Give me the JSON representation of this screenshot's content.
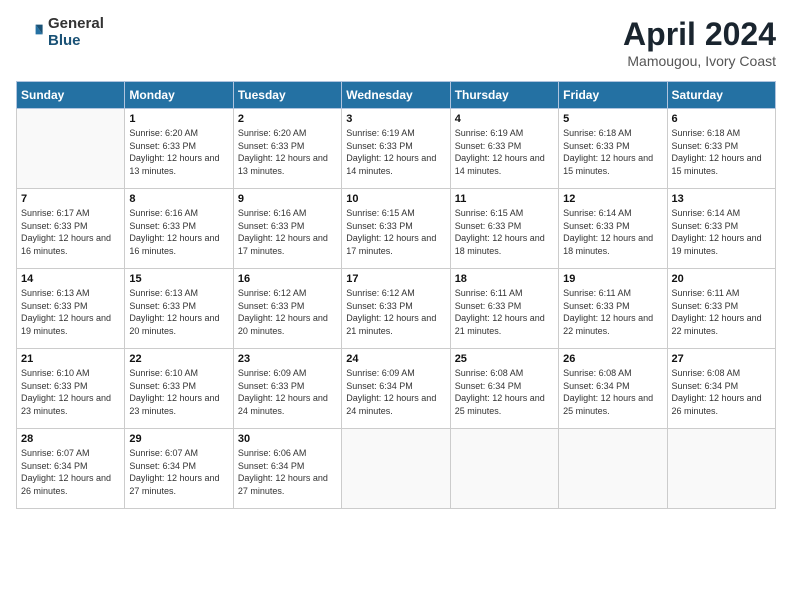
{
  "header": {
    "logo_general": "General",
    "logo_blue": "Blue",
    "title": "April 2024",
    "subtitle": "Mamougou, Ivory Coast"
  },
  "days_of_week": [
    "Sunday",
    "Monday",
    "Tuesday",
    "Wednesday",
    "Thursday",
    "Friday",
    "Saturday"
  ],
  "weeks": [
    [
      {
        "day": "",
        "empty": true
      },
      {
        "day": "1",
        "sunrise": "6:20 AM",
        "sunset": "6:33 PM",
        "daylight": "12 hours and 13 minutes."
      },
      {
        "day": "2",
        "sunrise": "6:20 AM",
        "sunset": "6:33 PM",
        "daylight": "12 hours and 13 minutes."
      },
      {
        "day": "3",
        "sunrise": "6:19 AM",
        "sunset": "6:33 PM",
        "daylight": "12 hours and 14 minutes."
      },
      {
        "day": "4",
        "sunrise": "6:19 AM",
        "sunset": "6:33 PM",
        "daylight": "12 hours and 14 minutes."
      },
      {
        "day": "5",
        "sunrise": "6:18 AM",
        "sunset": "6:33 PM",
        "daylight": "12 hours and 15 minutes."
      },
      {
        "day": "6",
        "sunrise": "6:18 AM",
        "sunset": "6:33 PM",
        "daylight": "12 hours and 15 minutes."
      }
    ],
    [
      {
        "day": "7",
        "sunrise": "6:17 AM",
        "sunset": "6:33 PM",
        "daylight": "12 hours and 16 minutes."
      },
      {
        "day": "8",
        "sunrise": "6:16 AM",
        "sunset": "6:33 PM",
        "daylight": "12 hours and 16 minutes."
      },
      {
        "day": "9",
        "sunrise": "6:16 AM",
        "sunset": "6:33 PM",
        "daylight": "12 hours and 17 minutes."
      },
      {
        "day": "10",
        "sunrise": "6:15 AM",
        "sunset": "6:33 PM",
        "daylight": "12 hours and 17 minutes."
      },
      {
        "day": "11",
        "sunrise": "6:15 AM",
        "sunset": "6:33 PM",
        "daylight": "12 hours and 18 minutes."
      },
      {
        "day": "12",
        "sunrise": "6:14 AM",
        "sunset": "6:33 PM",
        "daylight": "12 hours and 18 minutes."
      },
      {
        "day": "13",
        "sunrise": "6:14 AM",
        "sunset": "6:33 PM",
        "daylight": "12 hours and 19 minutes."
      }
    ],
    [
      {
        "day": "14",
        "sunrise": "6:13 AM",
        "sunset": "6:33 PM",
        "daylight": "12 hours and 19 minutes."
      },
      {
        "day": "15",
        "sunrise": "6:13 AM",
        "sunset": "6:33 PM",
        "daylight": "12 hours and 20 minutes."
      },
      {
        "day": "16",
        "sunrise": "6:12 AM",
        "sunset": "6:33 PM",
        "daylight": "12 hours and 20 minutes."
      },
      {
        "day": "17",
        "sunrise": "6:12 AM",
        "sunset": "6:33 PM",
        "daylight": "12 hours and 21 minutes."
      },
      {
        "day": "18",
        "sunrise": "6:11 AM",
        "sunset": "6:33 PM",
        "daylight": "12 hours and 21 minutes."
      },
      {
        "day": "19",
        "sunrise": "6:11 AM",
        "sunset": "6:33 PM",
        "daylight": "12 hours and 22 minutes."
      },
      {
        "day": "20",
        "sunrise": "6:11 AM",
        "sunset": "6:33 PM",
        "daylight": "12 hours and 22 minutes."
      }
    ],
    [
      {
        "day": "21",
        "sunrise": "6:10 AM",
        "sunset": "6:33 PM",
        "daylight": "12 hours and 23 minutes."
      },
      {
        "day": "22",
        "sunrise": "6:10 AM",
        "sunset": "6:33 PM",
        "daylight": "12 hours and 23 minutes."
      },
      {
        "day": "23",
        "sunrise": "6:09 AM",
        "sunset": "6:33 PM",
        "daylight": "12 hours and 24 minutes."
      },
      {
        "day": "24",
        "sunrise": "6:09 AM",
        "sunset": "6:34 PM",
        "daylight": "12 hours and 24 minutes."
      },
      {
        "day": "25",
        "sunrise": "6:08 AM",
        "sunset": "6:34 PM",
        "daylight": "12 hours and 25 minutes."
      },
      {
        "day": "26",
        "sunrise": "6:08 AM",
        "sunset": "6:34 PM",
        "daylight": "12 hours and 25 minutes."
      },
      {
        "day": "27",
        "sunrise": "6:08 AM",
        "sunset": "6:34 PM",
        "daylight": "12 hours and 26 minutes."
      }
    ],
    [
      {
        "day": "28",
        "sunrise": "6:07 AM",
        "sunset": "6:34 PM",
        "daylight": "12 hours and 26 minutes."
      },
      {
        "day": "29",
        "sunrise": "6:07 AM",
        "sunset": "6:34 PM",
        "daylight": "12 hours and 27 minutes."
      },
      {
        "day": "30",
        "sunrise": "6:06 AM",
        "sunset": "6:34 PM",
        "daylight": "12 hours and 27 minutes."
      },
      {
        "day": "",
        "empty": true
      },
      {
        "day": "",
        "empty": true
      },
      {
        "day": "",
        "empty": true
      },
      {
        "day": "",
        "empty": true
      }
    ]
  ],
  "labels": {
    "sunrise": "Sunrise:",
    "sunset": "Sunset:",
    "daylight": "Daylight:"
  }
}
